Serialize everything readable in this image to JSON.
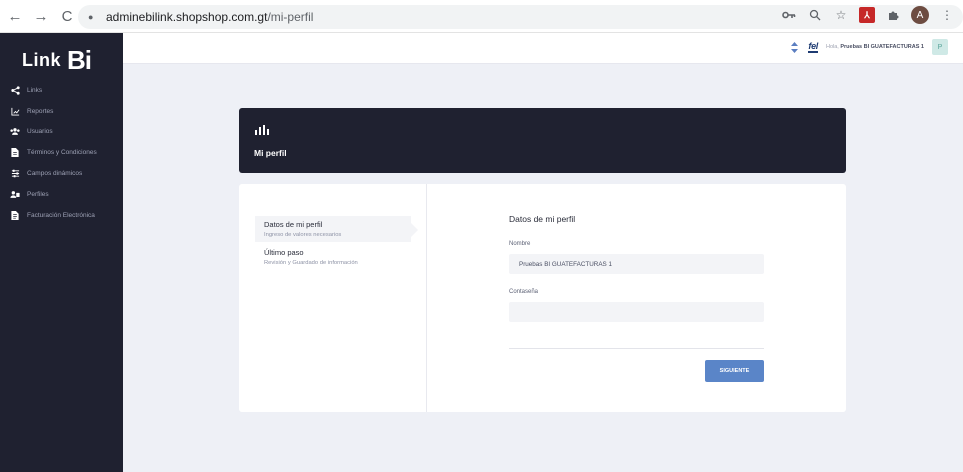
{
  "browser": {
    "back_icon": "←",
    "forward_icon": "→",
    "reload_icon": "C",
    "url_host": "adminebilink.shopshop.com.gt",
    "url_path": "/mi-perfil",
    "avatar_initial": "A"
  },
  "sidebar": {
    "logo_word": "Link",
    "logo_bi": "Bi",
    "items": [
      {
        "label": "Links",
        "icon": "share-icon"
      },
      {
        "label": "Reportes",
        "icon": "chart-icon"
      },
      {
        "label": "Usuarios",
        "icon": "users-icon"
      },
      {
        "label": "Términos y Condiciones",
        "icon": "document-icon"
      },
      {
        "label": "Campos dinámicos",
        "icon": "sliders-icon"
      },
      {
        "label": "Perfiles",
        "icon": "profiles-icon"
      },
      {
        "label": "Facturación Electrónica",
        "icon": "invoice-icon"
      }
    ]
  },
  "topbar": {
    "fel_logo": "fel",
    "greeting_prefix": "Hola,",
    "user_name": "Pruebas BI GUATEFACTURAS 1",
    "user_initial": "P"
  },
  "page": {
    "title": "Mi perfil"
  },
  "steps": [
    {
      "title": "Datos de mi perfil",
      "desc": "Ingreso de valores necesarios"
    },
    {
      "title": "Último paso",
      "desc": "Revisión y Guardado de información"
    }
  ],
  "form": {
    "title": "Datos de mi perfil",
    "name_label": "Nombre",
    "name_value": "Pruebas BI GUATEFACTURAS 1",
    "password_label": "Contaseña",
    "password_value": "",
    "next_label": "SIGUIENTE"
  },
  "colors": {
    "sidebar_bg": "#1f2130",
    "accent_button": "#5a85c8",
    "page_bg": "#eef0f6"
  }
}
